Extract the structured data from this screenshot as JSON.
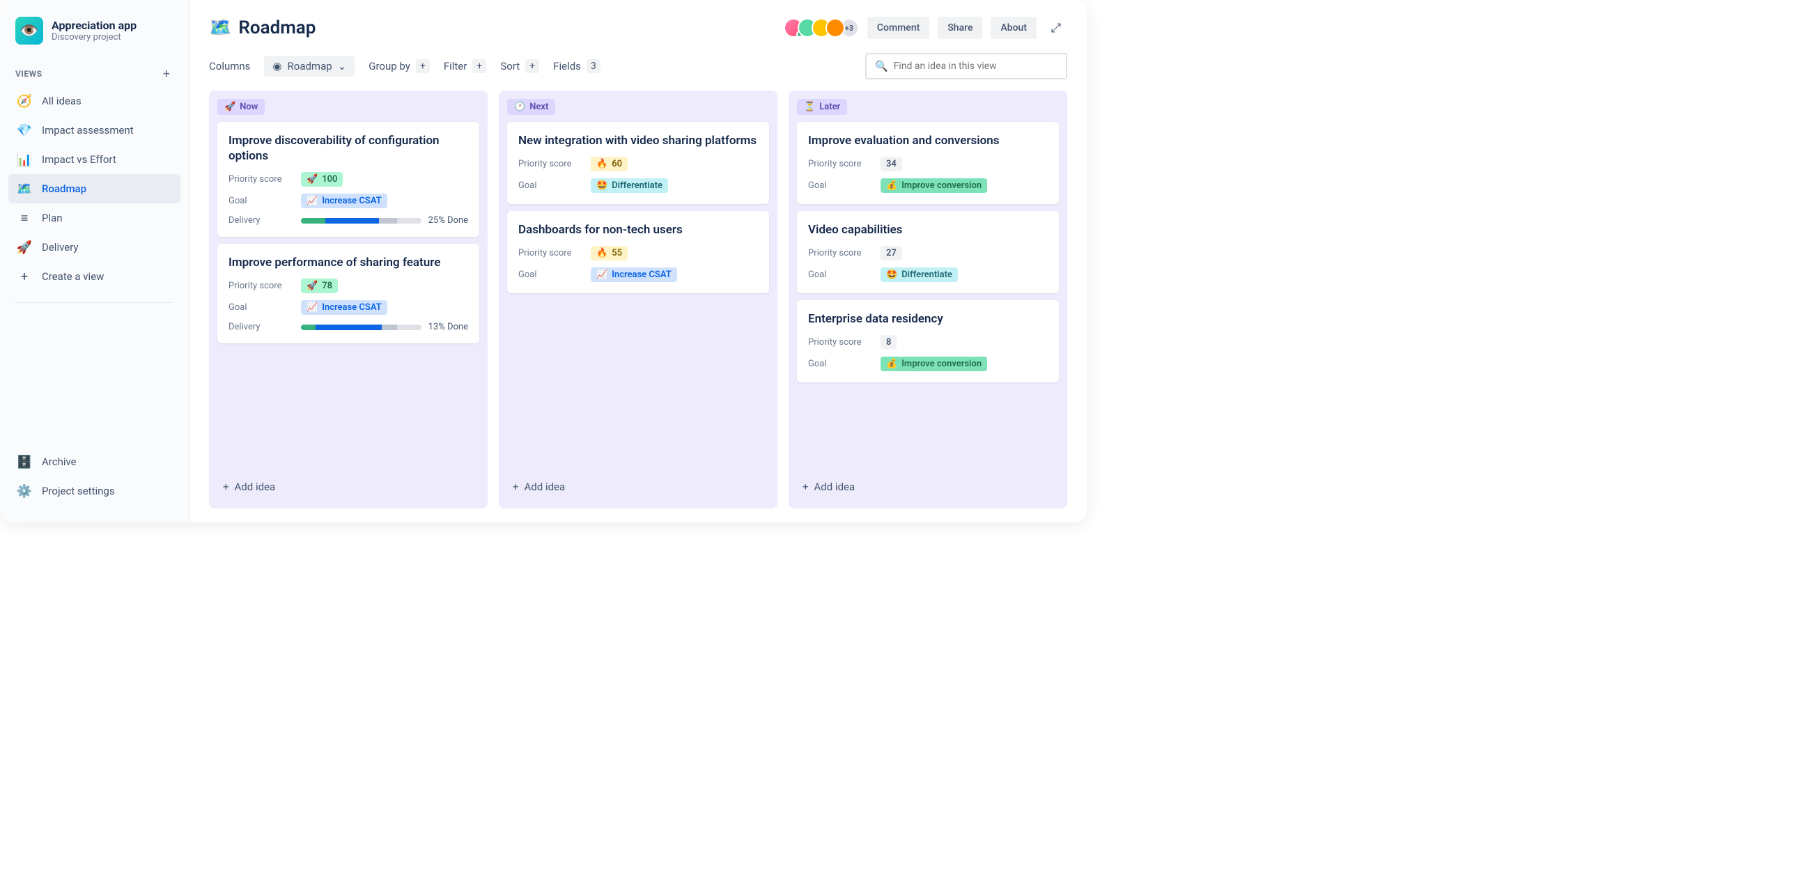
{
  "app": {
    "name": "Appreciation app",
    "subtitle": "Discovery project"
  },
  "sidebar": {
    "views_label": "VIEWS",
    "items": [
      {
        "icon": "🧭",
        "label": "All ideas"
      },
      {
        "icon": "💎",
        "label": "Impact assessment"
      },
      {
        "icon": "📊",
        "label": "Impact vs Effort"
      },
      {
        "icon": "🗺️",
        "label": "Roadmap"
      },
      {
        "icon": "≡",
        "label": "Plan"
      },
      {
        "icon": "🚀",
        "label": "Delivery"
      },
      {
        "icon": "+",
        "label": "Create a view"
      }
    ],
    "archive": "Archive",
    "settings": "Project settings"
  },
  "header": {
    "title_icon": "🗺️",
    "title": "Roadmap",
    "avatar_more": "+3",
    "buttons": {
      "comment": "Comment",
      "share": "Share",
      "about": "About"
    }
  },
  "toolbar": {
    "columns": "Columns",
    "roadmap": "Roadmap",
    "group_by": "Group by",
    "filter": "Filter",
    "sort": "Sort",
    "fields": "Fields",
    "fields_count": "3",
    "search_placeholder": "Find an idea in this view"
  },
  "board": {
    "columns": [
      {
        "icon": "🚀",
        "label": "Now",
        "cards": [
          {
            "title": "Improve discoverability of configuration options",
            "priority_label": "Priority score",
            "priority_icon": "🚀",
            "priority_value": "100",
            "priority_style": "badge-green",
            "goal_label": "Goal",
            "goal_icon": "📈",
            "goal_value": "Increase CSAT",
            "goal_style": "badge-blue",
            "delivery_label": "Delivery",
            "delivery_done": "25% Done",
            "progress": [
              {
                "color": "#36b37e",
                "pct": 20
              },
              {
                "color": "#0c66e4",
                "pct": 45
              },
              {
                "color": "#c1c7d0",
                "pct": 15
              }
            ]
          },
          {
            "title": "Improve performance of sharing feature",
            "priority_label": "Priority score",
            "priority_icon": "🚀",
            "priority_value": "78",
            "priority_style": "badge-green",
            "goal_label": "Goal",
            "goal_icon": "📈",
            "goal_value": "Increase CSAT",
            "goal_style": "badge-blue",
            "delivery_label": "Delivery",
            "delivery_done": "13% Done",
            "progress": [
              {
                "color": "#36b37e",
                "pct": 12
              },
              {
                "color": "#0c66e4",
                "pct": 55
              },
              {
                "color": "#c1c7d0",
                "pct": 13
              }
            ]
          }
        ],
        "add": "Add idea"
      },
      {
        "icon": "🕐",
        "label": "Next",
        "cards": [
          {
            "title": "New integration with video sharing platforms",
            "priority_label": "Priority score",
            "priority_icon": "🔥",
            "priority_value": "60",
            "priority_style": "badge-yellow",
            "goal_label": "Goal",
            "goal_icon": "🤩",
            "goal_value": "Differentiate",
            "goal_style": "badge-teal"
          },
          {
            "title": "Dashboards for non-tech users",
            "priority_label": "Priority score",
            "priority_icon": "🔥",
            "priority_value": "55",
            "priority_style": "badge-yellow",
            "goal_label": "Goal",
            "goal_icon": "📈",
            "goal_value": "Increase CSAT",
            "goal_style": "badge-blue"
          }
        ],
        "add": "Add idea"
      },
      {
        "icon": "⏳",
        "label": "Later",
        "cards": [
          {
            "title": "Improve evaluation and conversions",
            "priority_label": "Priority score",
            "priority_value": "34",
            "priority_style": "badge-grey",
            "goal_label": "Goal",
            "goal_icon": "💰",
            "goal_value": "Improve conversion",
            "goal_style": "badge-lime"
          },
          {
            "title": "Video capabilities",
            "priority_label": "Priority score",
            "priority_value": "27",
            "priority_style": "badge-grey",
            "goal_label": "Goal",
            "goal_icon": "🤩",
            "goal_value": "Differentiate",
            "goal_style": "badge-teal"
          },
          {
            "title": "Enterprise data residency",
            "priority_label": "Priority score",
            "priority_value": "8",
            "priority_style": "badge-grey",
            "goal_label": "Goal",
            "goal_icon": "💰",
            "goal_value": "Improve conversion",
            "goal_style": "badge-lime"
          }
        ],
        "add": "Add idea"
      }
    ]
  }
}
